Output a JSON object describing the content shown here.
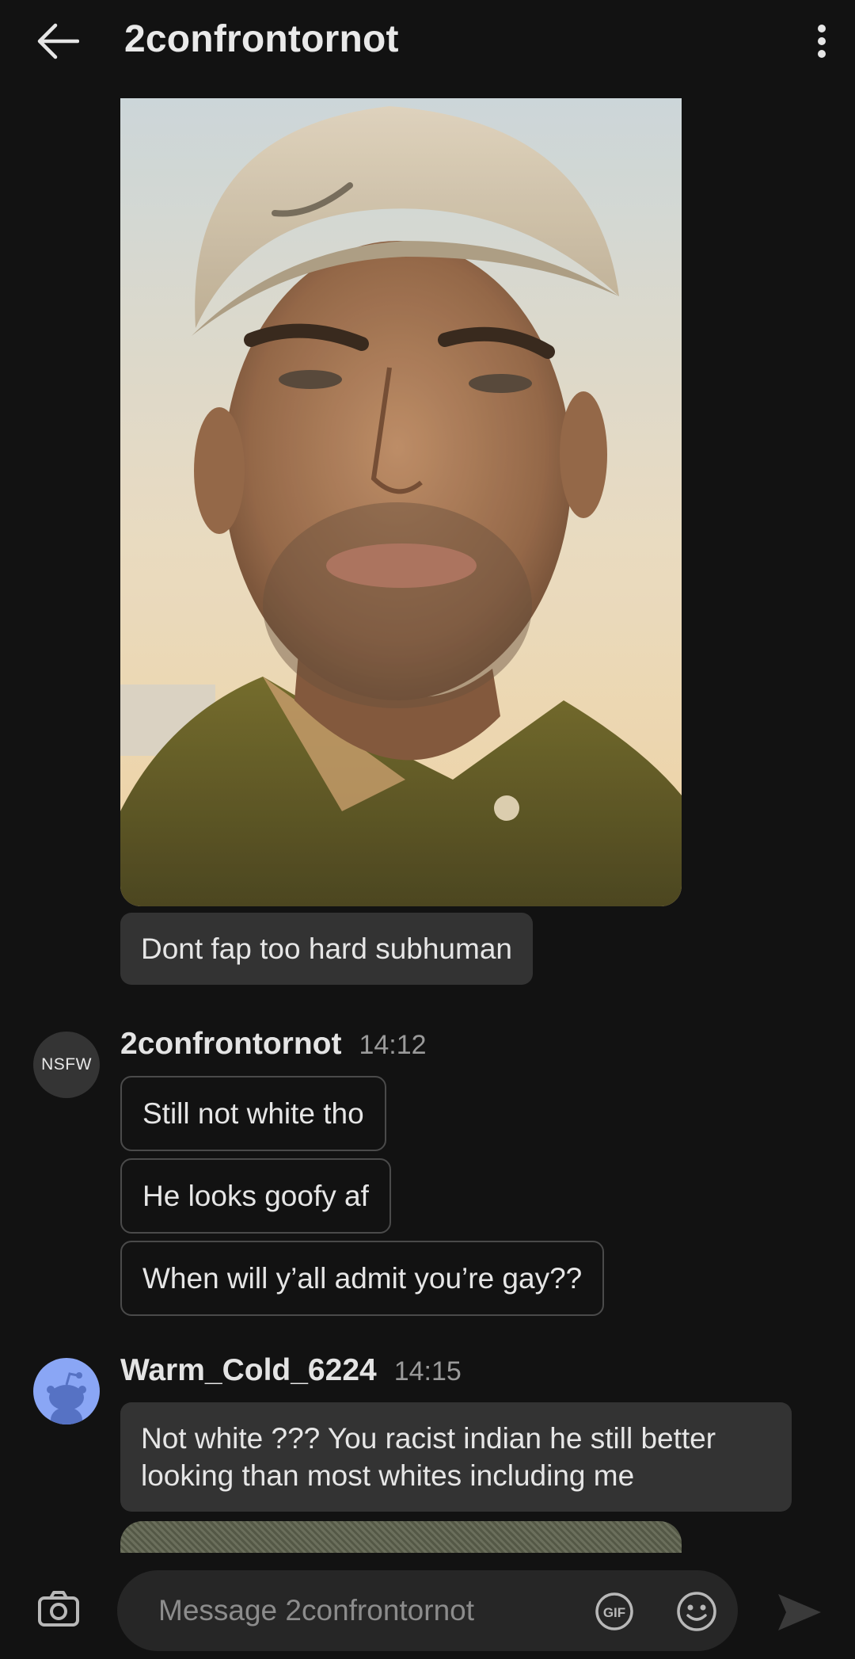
{
  "header": {
    "title": "2confrontornot",
    "back_icon": "arrow-left-icon",
    "menu_icon": "more-vertical-icon"
  },
  "messages": {
    "first_group": {
      "image_description_icon": "selfie-photo",
      "text": "Dont fap too hard subhuman"
    },
    "second_group": {
      "avatar_label": "NSFW",
      "sender": "2confrontornot",
      "time": "14:12",
      "texts": [
        "Still not white tho",
        "He looks goofy af",
        "When will y’all admit you’re gay??"
      ]
    },
    "third_group": {
      "avatar_icon": "snoo-avatar-icon",
      "sender": "Warm_Cold_6224",
      "time": "14:15",
      "text_line1": "Not white ??? You racist indian he still better",
      "text_line2": "looking than most whites including me"
    }
  },
  "composer": {
    "placeholder": "Message 2confrontornot",
    "gif_label": "GIF",
    "camera_icon": "camera-icon",
    "emoji_icon": "smiley-icon",
    "send_icon": "send-icon"
  },
  "colors": {
    "background": "#121212",
    "bubble_fill": "#333333",
    "bubble_outline": "#4a4a4a",
    "input_bg": "#262626",
    "snoo_avatar_bg": "#8aa6f5"
  }
}
